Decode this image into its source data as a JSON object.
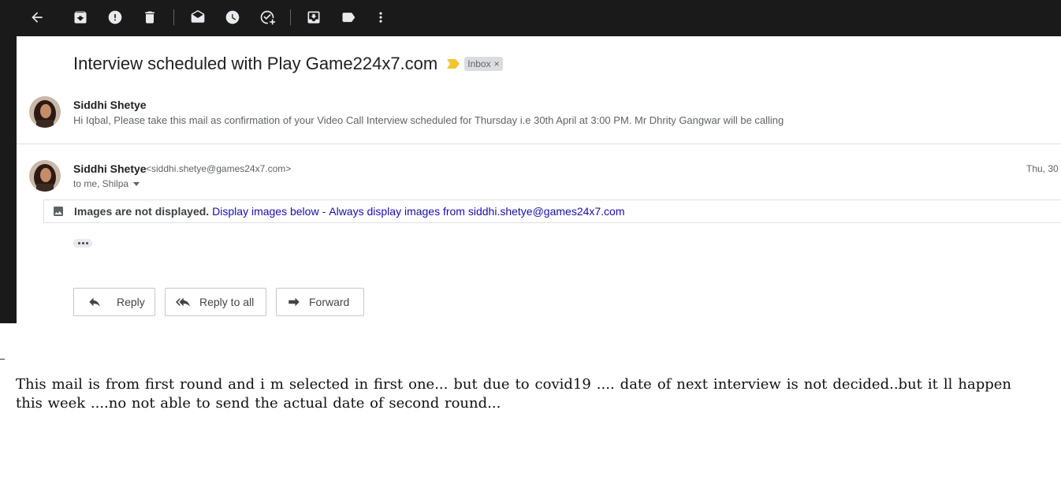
{
  "toolbar": {
    "buttons": [
      "back-icon",
      "archive-icon",
      "report-spam-icon",
      "delete-icon",
      "mark-unread-icon",
      "snooze-icon",
      "add-to-tasks-icon",
      "move-to-icon",
      "labels-icon",
      "more-icon"
    ]
  },
  "thread": {
    "subject": "Interview scheduled with Play Game224x7.com",
    "label_chip": "Inbox",
    "label_chip_close": "×",
    "accent_important": "#f4c430"
  },
  "message1": {
    "sender": "Siddhi Shetye",
    "snippet": "Hi Iqbal, Please take this mail as confirmation of your Video Call Interview scheduled for Thursday i.e 30th April at 3:00 PM. Mr Dhrity Gangwar will be calling"
  },
  "message2": {
    "sender": "Siddhi Shetye",
    "email": "<siddhi.shetye@games24x7.com>",
    "date": "Thu, 30",
    "recipients": "to me, Shilpa"
  },
  "images_notice": {
    "text": "Images are not displayed.",
    "display_link": "Display images below",
    "separator": "-",
    "always_link": "Always display images from siddhi.shetye@games24x7.com"
  },
  "actions": {
    "reply": "Reply",
    "reply_all": "Reply to all",
    "forward": "Forward"
  },
  "comment": {
    "text": "This mail is from first round and i m selected in first one... but due to covid19 .... date of next interview is not decided..but it ll happen this week ....no not able to send the actual date of second round..."
  }
}
